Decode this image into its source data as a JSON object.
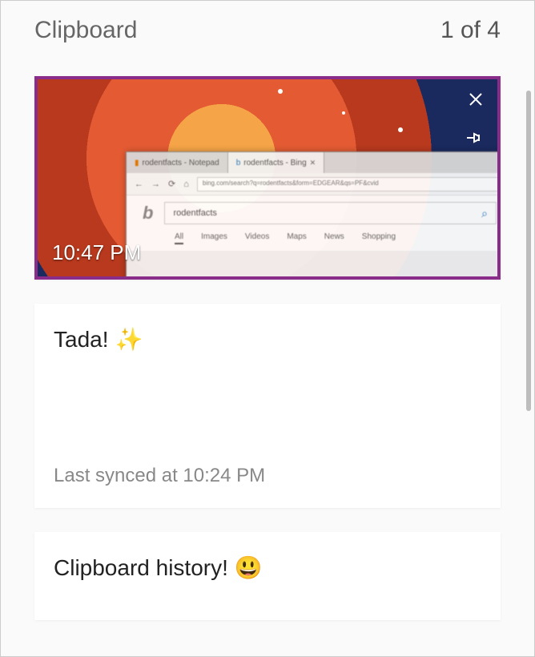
{
  "header": {
    "title": "Clipboard",
    "count_label": "1 of 4"
  },
  "items": [
    {
      "type": "image",
      "timestamp": "10:47 PM",
      "close_icon": "close-icon",
      "pin_icon": "pin-icon",
      "browser": {
        "tab1": "rodentfacts - Notepad",
        "tab2": "rodentfacts - Bing",
        "nav_back": "←",
        "nav_fwd": "→",
        "nav_refresh": "⟳",
        "nav_home": "⌂",
        "address": "bing.com/search?q=rodentfacts&form=EDGEAR&qs=PF&cvid",
        "bing_logo": "b",
        "search_query": "rodentfacts",
        "nav_items": [
          "All",
          "Images",
          "Videos",
          "Maps",
          "News",
          "Shopping"
        ]
      }
    },
    {
      "type": "text",
      "text": "Tada!",
      "emoji": "✨",
      "meta": "Last synced at 10:24 PM"
    },
    {
      "type": "text",
      "text": "Clipboard history!",
      "emoji": "😃"
    }
  ]
}
